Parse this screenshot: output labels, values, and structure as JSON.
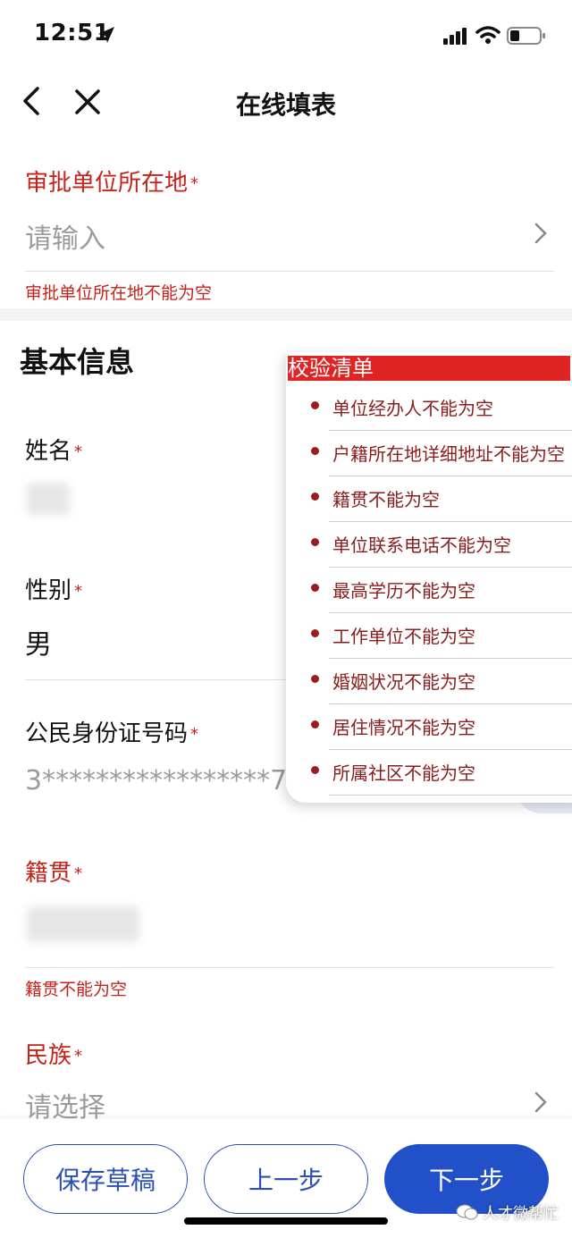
{
  "status_bar": {
    "time": "12:51"
  },
  "nav": {
    "title": "在线填表"
  },
  "approval_location": {
    "label": "审批单位所在地",
    "required": "*",
    "placeholder": "请输入",
    "error": "审批单位所在地不能为空"
  },
  "section_basic": {
    "title": "基本信息"
  },
  "name": {
    "label": "姓名",
    "required": "*"
  },
  "gender": {
    "label": "性别",
    "required": "*",
    "value": "男"
  },
  "id_number": {
    "label": "公民身份证号码",
    "required": "*",
    "value": "3*****************7"
  },
  "native_place": {
    "label": "籍贯",
    "required": "*",
    "error": "籍贯不能为空"
  },
  "ethnicity": {
    "label": "民族",
    "required": "*",
    "placeholder": "请选择"
  },
  "validation": {
    "title": "校验清单",
    "items": [
      "单位经办人不能为空",
      "户籍所在地详细地址不能为空",
      "籍贯不能为空",
      "单位联系电话不能为空",
      "最高学历不能为空",
      "工作单位不能为空",
      "婚姻状况不能为空",
      "居住情况不能为空",
      "所属社区不能为空"
    ]
  },
  "buttons": {
    "save_draft": "保存草稿",
    "prev": "上一步",
    "next": "下一步"
  },
  "watermark": {
    "text": "人才微帮忙"
  },
  "colors": {
    "error_red": "#c7221a",
    "primary_blue": "#2150c8",
    "popover_header": "#e02424"
  }
}
